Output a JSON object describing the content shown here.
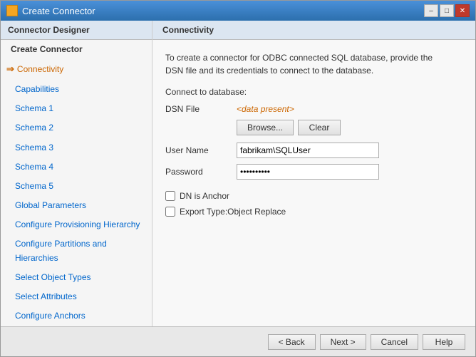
{
  "window": {
    "title": "Create Connector",
    "icon_label": "MS"
  },
  "sidebar": {
    "header": "Connector Designer",
    "items": [
      {
        "id": "create-connector",
        "label": "Create Connector",
        "indent": false,
        "active": false
      },
      {
        "id": "connectivity",
        "label": "Connectivity",
        "indent": false,
        "active": true,
        "arrow": true
      },
      {
        "id": "capabilities",
        "label": "Capabilities",
        "indent": true
      },
      {
        "id": "schema1",
        "label": "Schema 1",
        "indent": true
      },
      {
        "id": "schema2",
        "label": "Schema 2",
        "indent": true
      },
      {
        "id": "schema3",
        "label": "Schema 3",
        "indent": true
      },
      {
        "id": "schema4",
        "label": "Schema 4",
        "indent": true
      },
      {
        "id": "schema5",
        "label": "Schema 5",
        "indent": true
      },
      {
        "id": "global-parameters",
        "label": "Global Parameters",
        "indent": true
      },
      {
        "id": "configure-provisioning",
        "label": "Configure Provisioning Hierarchy",
        "indent": true
      },
      {
        "id": "configure-partitions",
        "label": "Configure Partitions and Hierarchies",
        "indent": true
      },
      {
        "id": "select-object-types",
        "label": "Select Object Types",
        "indent": true
      },
      {
        "id": "select-attributes",
        "label": "Select Attributes",
        "indent": true
      },
      {
        "id": "configure-anchors",
        "label": "Configure Anchors",
        "indent": true
      }
    ]
  },
  "panel": {
    "header": "Connectivity",
    "description": "To create a connector for ODBC connected SQL database, provide the DSN file and its credentials to connect to the database.",
    "connect_label": "Connect to database:",
    "dsn_label": "DSN File",
    "dsn_value": "<data present>",
    "browse_btn": "Browse...",
    "clear_btn": "Clear",
    "username_label": "User Name",
    "username_value": "fabrikam\\SQLUser",
    "password_label": "Password",
    "password_value": "••••••••••",
    "dn_anchor_label": "DN is Anchor",
    "export_label": "Export Type:Object Replace",
    "dn_anchor_checked": false,
    "export_checked": false
  },
  "footer": {
    "back_btn": "< Back",
    "next_btn": "Next >",
    "cancel_btn": "Cancel",
    "help_btn": "Help"
  }
}
